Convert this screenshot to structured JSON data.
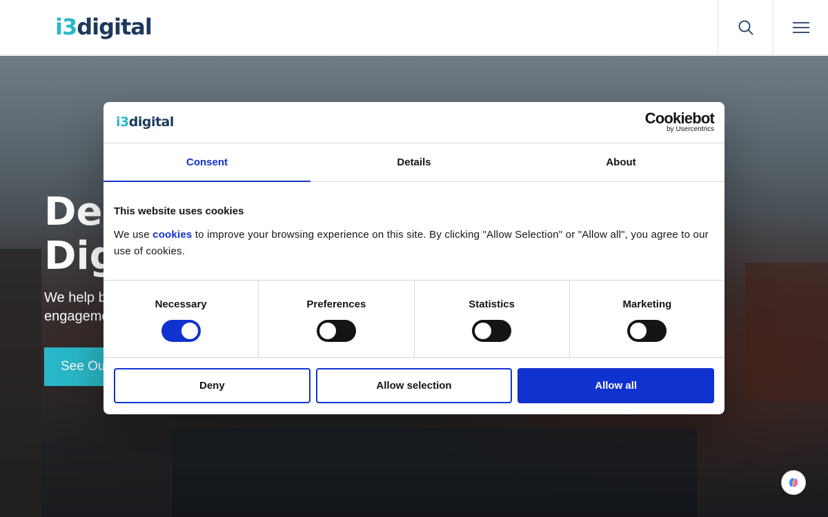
{
  "header": {
    "logo_prefix": "i3",
    "logo_suffix": "digital",
    "search_icon": "search-icon",
    "menu_icon": "hamburger-menu-icon"
  },
  "hero": {
    "title_line1": "Del",
    "title_line2": "Dig",
    "subtitle_line1": "We help b",
    "subtitle_line2": "engageme",
    "cta_label": "See Ou"
  },
  "cookie_dialog": {
    "logo_prefix": "i3",
    "logo_suffix": "digital",
    "brand": "Cookiebot",
    "brand_by": "by Usercentrics",
    "tabs": [
      {
        "label": "Consent",
        "active": true
      },
      {
        "label": "Details",
        "active": false
      },
      {
        "label": "About",
        "active": false
      }
    ],
    "title": "This website uses cookies",
    "text_before_link": "We use ",
    "link_text": "cookies",
    "text_after_link": " to improve your browsing experience on this site. By clicking \"Allow Selection\" or \"Allow all\", you agree to our use of cookies.",
    "categories": [
      {
        "label": "Necessary",
        "checked": true
      },
      {
        "label": "Preferences",
        "checked": false
      },
      {
        "label": "Statistics",
        "checked": false
      },
      {
        "label": "Marketing",
        "checked": false
      }
    ],
    "buttons": {
      "deny": "Deny",
      "allow_selection": "Allow selection",
      "allow_all": "Allow all"
    },
    "accent_color": "#1032cf"
  },
  "widget": {
    "icon": "copilot-icon"
  },
  "colors": {
    "brand_teal": "#29b8c9",
    "brand_navy": "#1d3a5c"
  }
}
